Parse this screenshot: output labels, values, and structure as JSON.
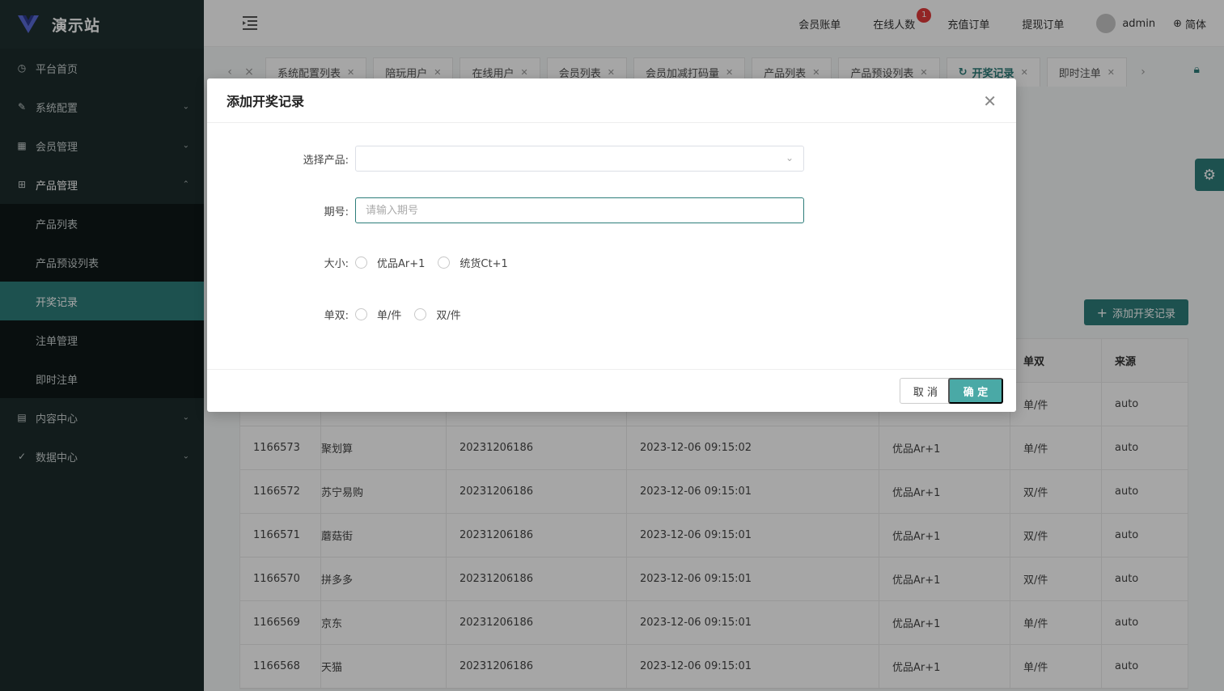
{
  "brand": {
    "name": "演示站"
  },
  "sidebar": {
    "items": [
      {
        "label": "平台首页",
        "icon": "dashboard-icon"
      },
      {
        "label": "系统配置",
        "icon": "edit-icon"
      },
      {
        "label": "会员管理",
        "icon": "table-icon"
      },
      {
        "label": "产品管理",
        "icon": "grid-icon"
      }
    ],
    "sub_items": [
      {
        "label": "产品列表"
      },
      {
        "label": "产品预设列表"
      },
      {
        "label": "开奖记录"
      },
      {
        "label": "注单管理"
      },
      {
        "label": "即时注单"
      }
    ],
    "bottom_items": [
      {
        "label": "内容中心",
        "icon": "document-icon"
      },
      {
        "label": "数据中心",
        "icon": "check-circle-icon"
      }
    ]
  },
  "header": {
    "links": [
      "会员账单",
      "在线人数",
      "充值订单",
      "提现订单"
    ],
    "online_badge": "1",
    "username": "admin",
    "language": "简体"
  },
  "tabs": [
    {
      "label": "系统配置列表"
    },
    {
      "label": "陪玩用户"
    },
    {
      "label": "在线用户"
    },
    {
      "label": "会员列表"
    },
    {
      "label": "会员加减打码量"
    },
    {
      "label": "产品列表"
    },
    {
      "label": "产品预设列表"
    },
    {
      "label": "开奖记录"
    },
    {
      "label": "即时注单"
    }
  ],
  "add_button": "添加开奖记录",
  "table": {
    "columns": [
      "",
      "",
      "",
      "",
      "",
      "单双",
      "来源"
    ],
    "rows": [
      [
        "",
        "",
        "",
        "",
        "",
        "单/件",
        "auto"
      ],
      [
        "1166573",
        "聚划算",
        "20231206186",
        "2023-12-06 09:15:02",
        "优品Ar+1",
        "单/件",
        "auto"
      ],
      [
        "1166572",
        "苏宁易购",
        "20231206186",
        "2023-12-06 09:15:01",
        "优品Ar+1",
        "双/件",
        "auto"
      ],
      [
        "1166571",
        "蘑菇街",
        "20231206186",
        "2023-12-06 09:15:01",
        "优品Ar+1",
        "双/件",
        "auto"
      ],
      [
        "1166570",
        "拼多多",
        "20231206186",
        "2023-12-06 09:15:01",
        "优品Ar+1",
        "双/件",
        "auto"
      ],
      [
        "1166569",
        "京东",
        "20231206186",
        "2023-12-06 09:15:01",
        "优品Ar+1",
        "单/件",
        "auto"
      ],
      [
        "1166568",
        "天猫",
        "20231206186",
        "2023-12-06 09:15:01",
        "优品Ar+1",
        "单/件",
        "auto"
      ]
    ]
  },
  "dialog": {
    "title": "添加开奖记录",
    "product_label": "选择产品:",
    "product_value": "",
    "period_label": "期号:",
    "period_placeholder": "请输入期号",
    "size_label": "大小:",
    "size_options": [
      "优品Ar+1",
      "统货Ct+1"
    ],
    "parity_label": "单双:",
    "parity_options": [
      "单/件",
      "双/件"
    ],
    "cancel_label": "取 消",
    "ok_label": "确 定"
  },
  "colors": {
    "accent": "#2d7d7a",
    "sidebar_bg": "#1c2b2b",
    "badge": "#e03a3a"
  }
}
